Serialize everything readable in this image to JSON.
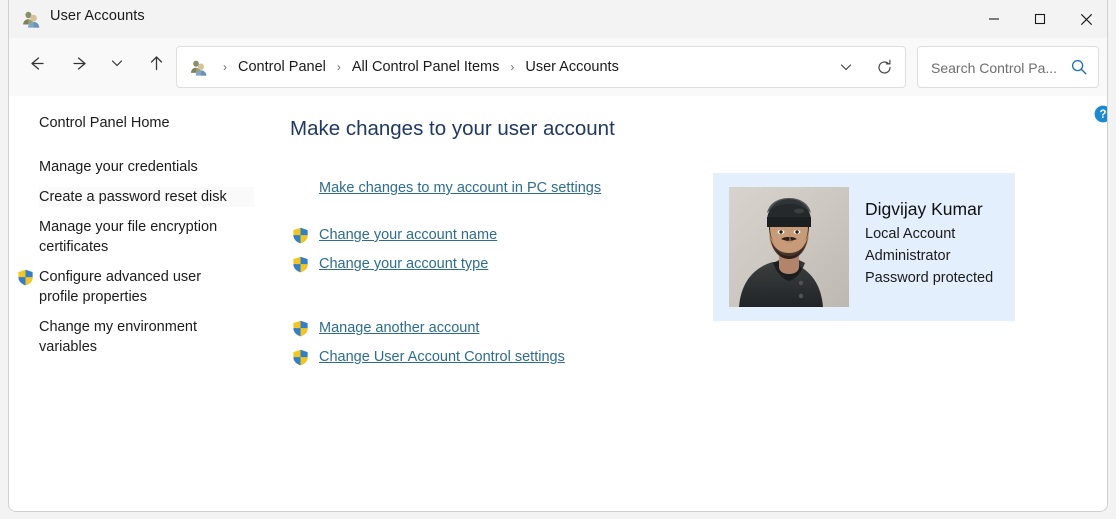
{
  "window": {
    "title": "User Accounts",
    "title_icon": "users-icon",
    "controls": {
      "minimize": "Minimize",
      "maximize": "Maximize",
      "close": "Close"
    }
  },
  "toolbar": {
    "back": "Back",
    "forward": "Forward",
    "recent": "Recent locations",
    "up": "Up",
    "address_icon": "users-icon",
    "breadcrumbs": [
      "Control Panel",
      "All Control Panel Items",
      "User Accounts"
    ],
    "separator": "›",
    "previous_locations": "Previous locations",
    "refresh": "Refresh",
    "search": {
      "placeholder": "Search Control Pa...",
      "value": "",
      "icon": "search-icon"
    }
  },
  "help": {
    "label": "Help",
    "icon": "help-circle-icon"
  },
  "sidebar": {
    "items": [
      {
        "label": "Control Panel Home",
        "shield": false
      },
      {
        "label": "Manage your credentials",
        "shield": false
      },
      {
        "label": "Create a password reset disk",
        "shield": false
      },
      {
        "label": "Manage your file encryption\ncertificates",
        "shield": false
      },
      {
        "label": "Configure advanced user\nprofile properties",
        "shield": true
      },
      {
        "label": "Change my environment\nvariables",
        "shield": false
      }
    ]
  },
  "main": {
    "heading": "Make changes to your user account",
    "links": [
      {
        "label": "Make changes to my account in PC settings",
        "shield": false
      },
      {
        "label": "Change your account name",
        "shield": true
      },
      {
        "label": "Change your account type",
        "shield": true
      },
      {
        "label": "Manage another account",
        "shield": true
      },
      {
        "label": "Change User Account Control settings",
        "shield": true
      }
    ],
    "account": {
      "avatar_alt": "Account picture",
      "name": "Digvijay Kumar",
      "account_type": "Local Account",
      "role": "Administrator",
      "password_status": "Password protected"
    }
  },
  "colors": {
    "heading": "#1f3864",
    "link": "#2c6d8f",
    "card_background": "#e3effc",
    "titlebar": "#f3f3f3",
    "toolbar": "#f9f9f9",
    "shield_yellow": "#f5c518",
    "shield_blue": "#2f7fd1",
    "help_blue": "#1a8ad4"
  }
}
